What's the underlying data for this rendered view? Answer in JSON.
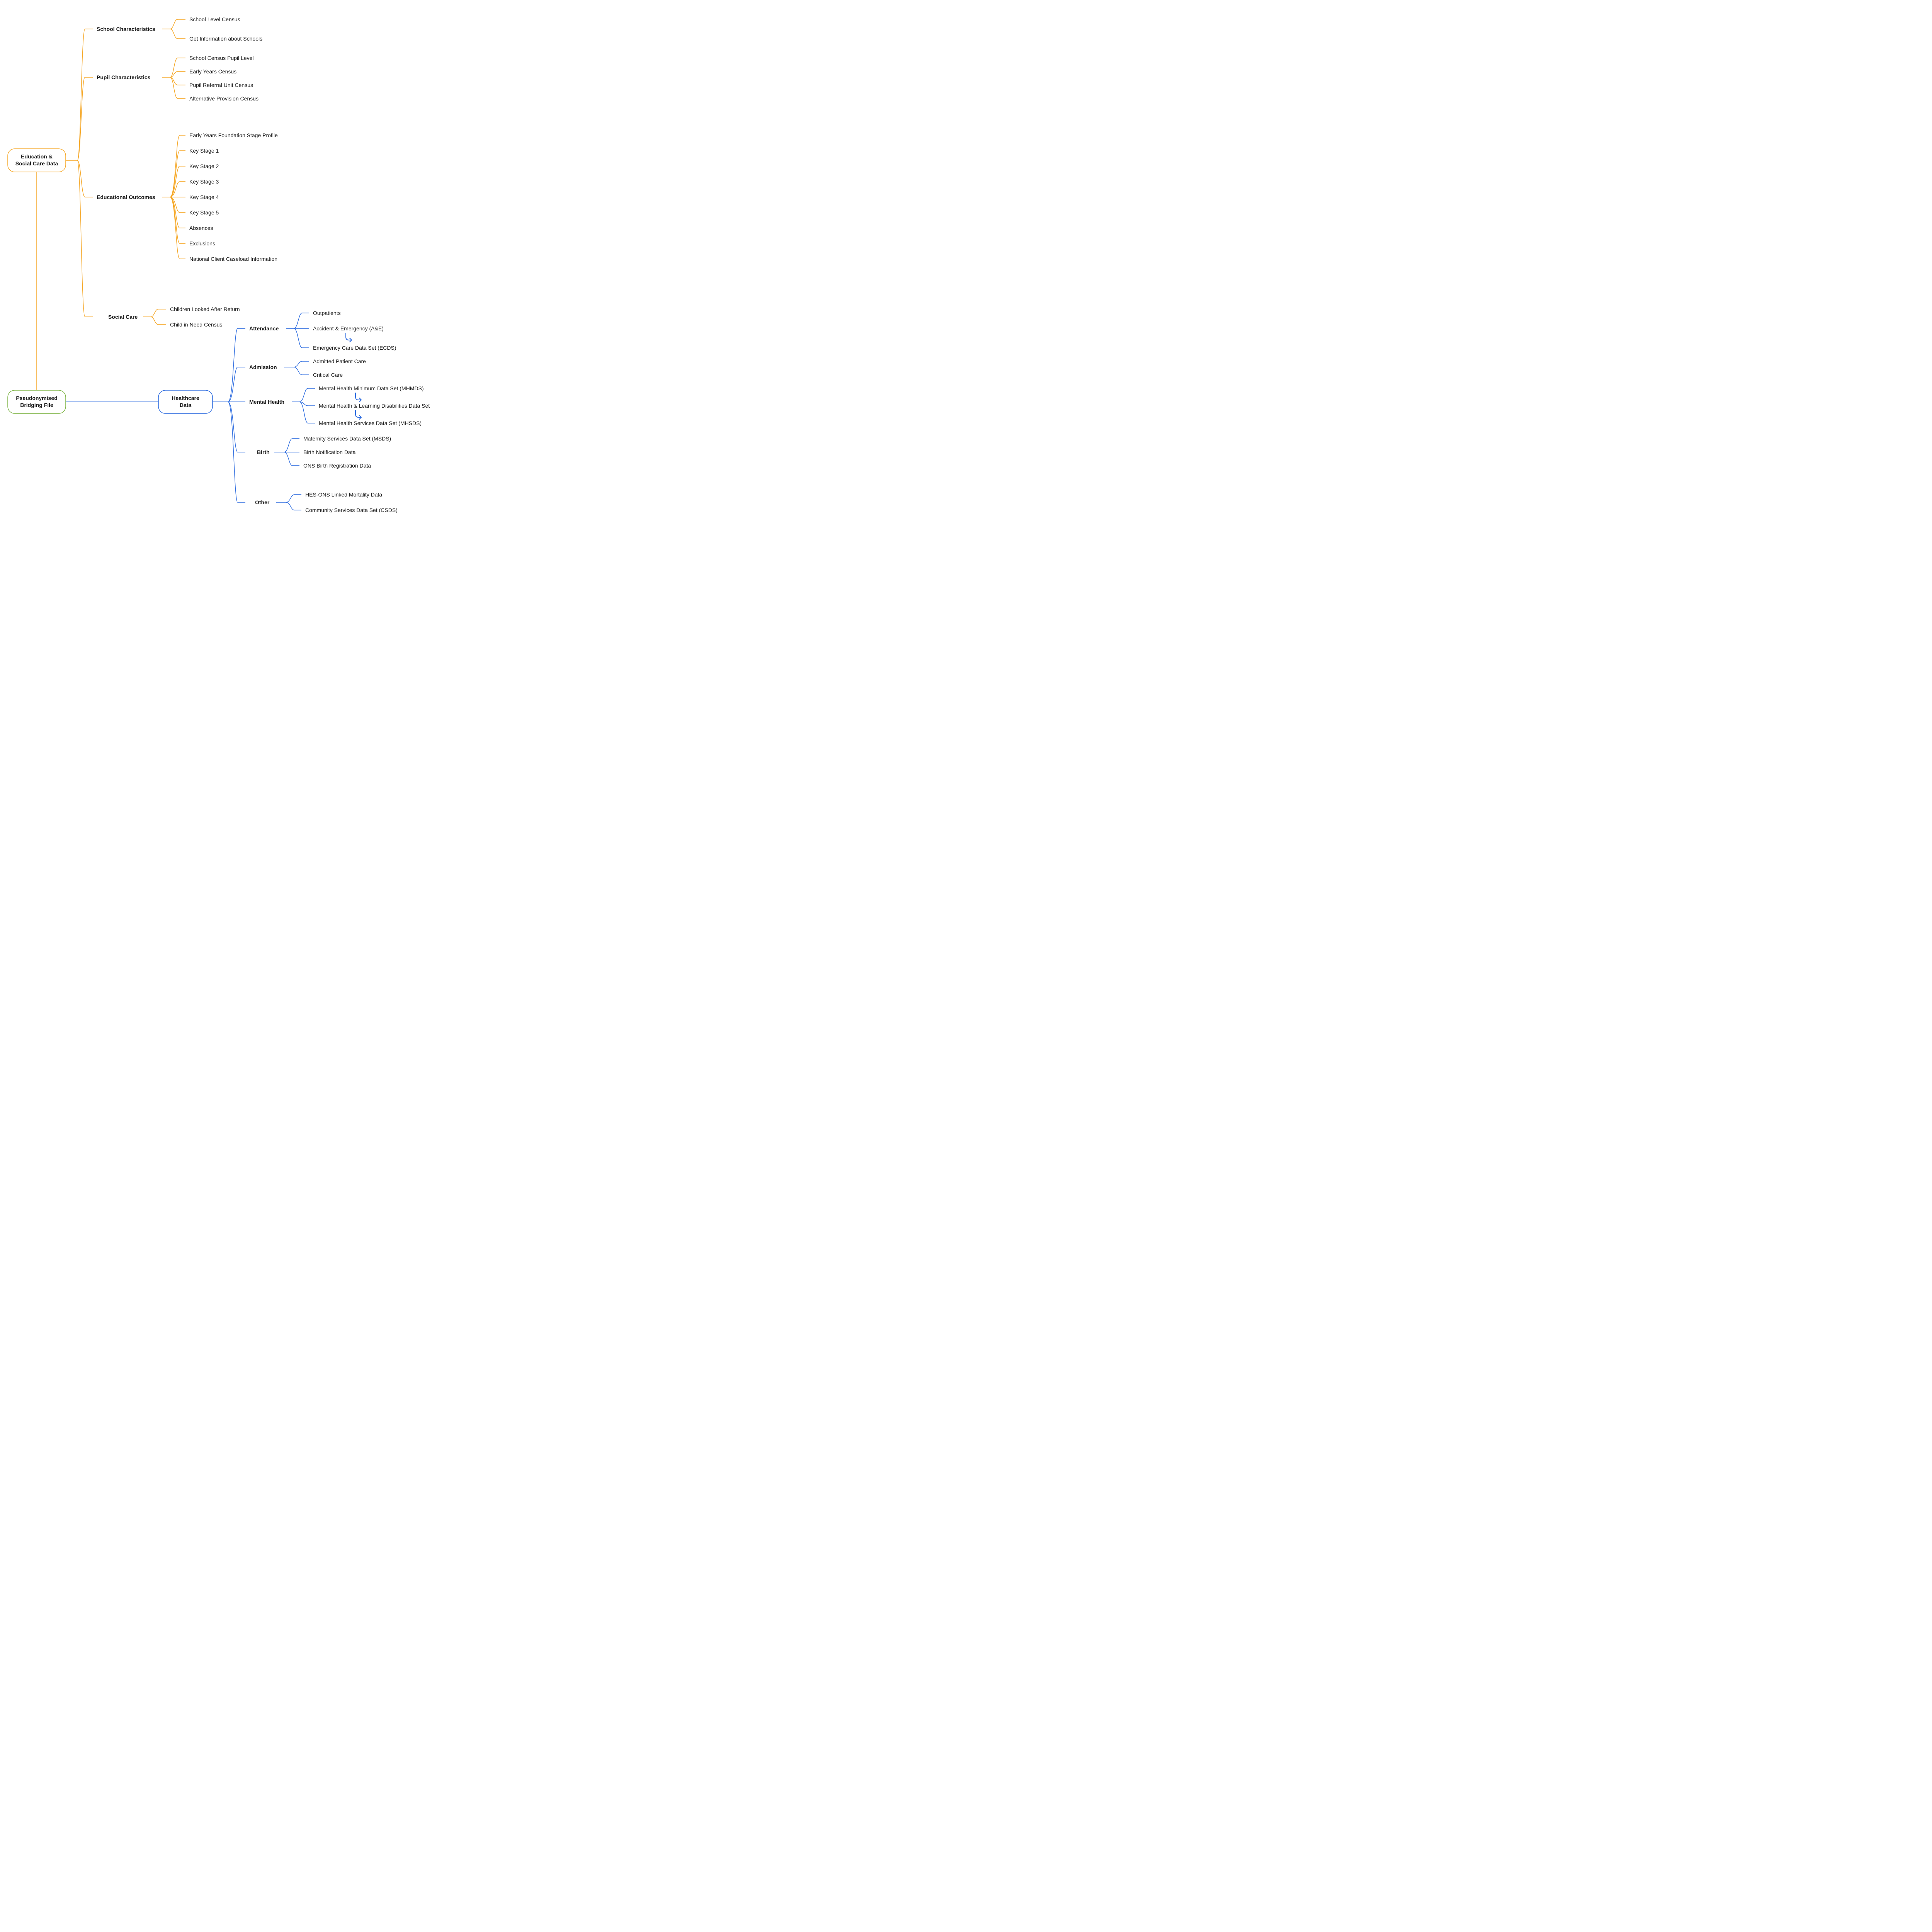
{
  "root_bridge": {
    "l1": "Pseudonymised",
    "l2": "Bridging File"
  },
  "root_edu": {
    "l1": "Education &",
    "l2": "Social Care Data"
  },
  "root_health": {
    "l1": "Healthcare",
    "l2": "Data"
  },
  "edu": {
    "school_char": {
      "title": "School Characteristics",
      "items": [
        "School Level Census",
        "Get Information about Schools"
      ]
    },
    "pupil_char": {
      "title": "Pupil Characteristics",
      "items": [
        "School Census Pupil Level",
        "Early Years Census",
        "Pupil Referral Unit Census",
        "Alternative Provision Census"
      ]
    },
    "edu_out": {
      "title": "Educational Outcomes",
      "items": [
        "Early Years Foundation Stage Profile",
        "Key Stage 1",
        "Key Stage 2",
        "Key Stage 3",
        "Key Stage 4",
        "Key Stage 5",
        "Absences",
        "Exclusions",
        "National Client Caseload Information"
      ]
    },
    "social_care": {
      "title": "Social Care",
      "items": [
        "Children Looked After Return",
        "Child in Need Census"
      ]
    }
  },
  "health": {
    "attendance": {
      "title": "Attendance",
      "items": [
        "Outpatients",
        "Accident & Emergency (A&E)",
        "Emergency Care Data Set (ECDS)"
      ]
    },
    "admission": {
      "title": "Admission",
      "items": [
        "Admitted Patient Care",
        "Critical Care"
      ]
    },
    "mental": {
      "title": "Mental Health",
      "items": [
        "Mental Health Minimum Data Set (MHMDS)",
        "Mental Health & Learning Disabilities Data Set",
        "Mental Health Services Data Set (MHSDS)"
      ]
    },
    "birth": {
      "title": "Birth",
      "items": [
        "Maternity Services Data Set (MSDS)",
        "Birth Notification Data",
        "ONS Birth Registration Data"
      ]
    },
    "other": {
      "title": "Other",
      "items": [
        "HES-ONS Linked Mortality Data",
        "Community Services Data Set (CSDS)"
      ]
    }
  },
  "colors": {
    "orange": "#f5a623",
    "blue": "#2d6cdf",
    "green": "#7cb342"
  }
}
